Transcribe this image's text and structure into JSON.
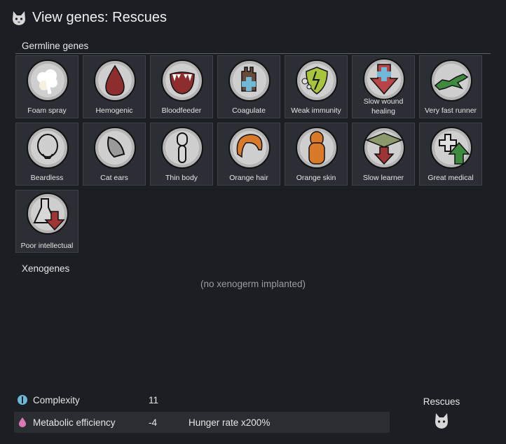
{
  "window": {
    "title": "View genes: Rescues",
    "icon": "cat-head-icon"
  },
  "germline": {
    "heading": "Germline genes",
    "genes": [
      {
        "label": "Foam spray",
        "icon": "foam-spray-icon"
      },
      {
        "label": "Hemogenic",
        "icon": "blood-drop-icon"
      },
      {
        "label": "Bloodfeeder",
        "icon": "fanged-mouth-icon"
      },
      {
        "label": "Coagulate",
        "icon": "glove-medical-cross-icon"
      },
      {
        "label": "Weak immunity",
        "icon": "cracked-shield-virus-icon"
      },
      {
        "label": "Slow wound healing",
        "icon": "medical-cross-down-arrow-icon"
      },
      {
        "label": "Very fast runner",
        "icon": "running-animal-icon"
      },
      {
        "label": "Beardless",
        "icon": "bald-head-icon"
      },
      {
        "label": "Cat ears",
        "icon": "cat-ear-icon"
      },
      {
        "label": "Thin body",
        "icon": "thin-body-icon"
      },
      {
        "label": "Orange hair",
        "icon": "orange-hair-icon"
      },
      {
        "label": "Orange skin",
        "icon": "orange-body-icon"
      },
      {
        "label": "Slow learner",
        "icon": "graduation-cap-down-arrow-icon"
      },
      {
        "label": "Great medical",
        "icon": "medical-cross-up-arrow-icon"
      },
      {
        "label": "Poor intellectual",
        "icon": "flask-down-arrow-icon"
      }
    ]
  },
  "xenogenes": {
    "heading": "Xenogenes",
    "empty_text": "(no xenogerm implanted)"
  },
  "stats": [
    {
      "name": "Complexity",
      "value": "11",
      "note": "",
      "icon": "complexity-icon",
      "color": "#6cb6d8"
    },
    {
      "name": "Metabolic efficiency",
      "value": "-4",
      "note": "Hunger rate x200%",
      "icon": "metabolism-drop-icon",
      "color": "#d97ab8"
    }
  ],
  "xenotype": {
    "name": "Rescues",
    "icon": "cat-head-icon"
  },
  "colors": {
    "background": "#1b1e23",
    "tile": "#2b2f35",
    "red": "#9e3534",
    "green": "#3e8a3e",
    "orange": "#d9792a"
  }
}
